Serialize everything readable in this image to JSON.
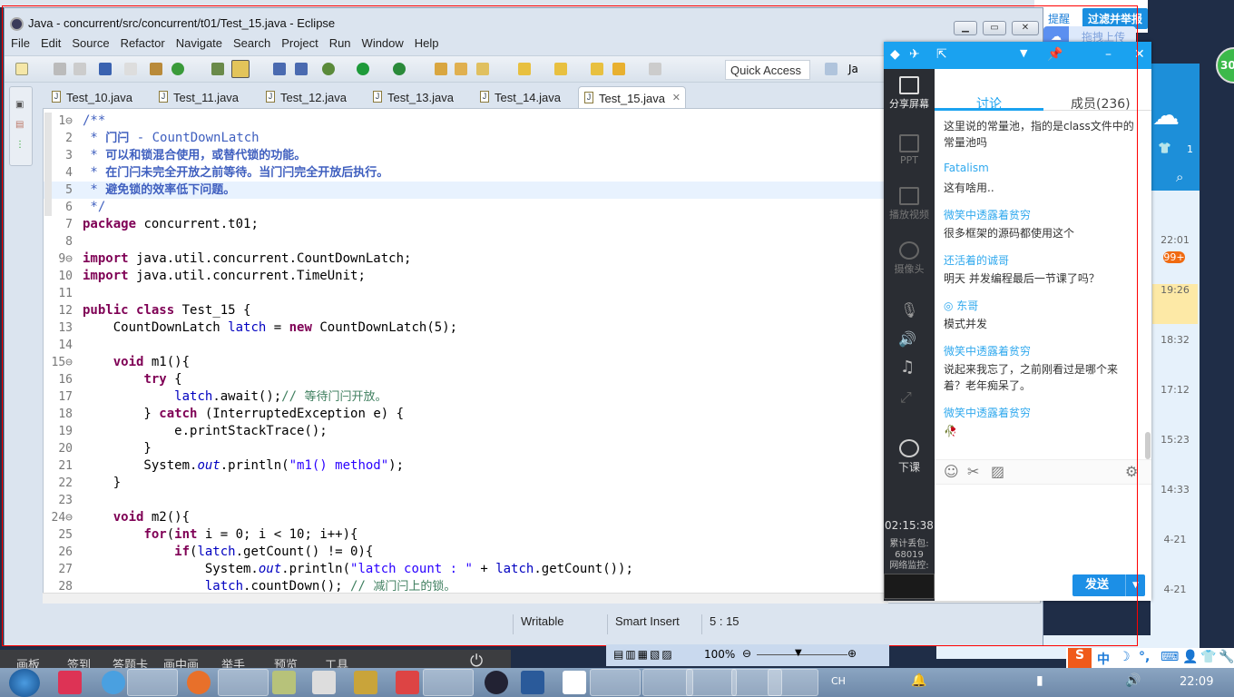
{
  "window": {
    "title": "Java - concurrent/src/concurrent/t01/Test_15.java - Eclipse"
  },
  "menu": [
    "File",
    "Edit",
    "Source",
    "Refactor",
    "Navigate",
    "Search",
    "Project",
    "Run",
    "Window",
    "Help"
  ],
  "toolbar": {
    "quick_access": "Quick Access",
    "perspective": "Ja"
  },
  "tabs": [
    {
      "label": "Test_10.java"
    },
    {
      "label": "Test_11.java"
    },
    {
      "label": "Test_12.java"
    },
    {
      "label": "Test_13.java"
    },
    {
      "label": "Test_14.java"
    },
    {
      "label": "Test_15.java",
      "active": true
    }
  ],
  "editor": {
    "current_line": 5,
    "lines": [
      [
        [
          "c",
          "/**"
        ]
      ],
      [
        [
          "c",
          " * "
        ],
        [
          "cz",
          "门闩"
        ],
        [
          "c",
          " - CountDownLatch"
        ]
      ],
      [
        [
          "c",
          " * "
        ],
        [
          "cz",
          "可以和锁混合使用，或替代锁的功能。"
        ]
      ],
      [
        [
          "c",
          " * "
        ],
        [
          "cz",
          "在门闩未完全开放之前等待。当门闩完全开放后执行。"
        ]
      ],
      [
        [
          "c",
          " * "
        ],
        [
          "cz",
          "避免锁的效率低下问题。"
        ]
      ],
      [
        [
          "c",
          " */"
        ]
      ],
      [
        [
          "k",
          "package"
        ],
        [
          "t",
          " concurrent.t01;"
        ]
      ],
      [],
      [
        [
          "k",
          "import"
        ],
        [
          "t",
          " java.util.concurrent.CountDownLatch;"
        ]
      ],
      [
        [
          "k",
          "import"
        ],
        [
          "t",
          " java.util.concurrent.TimeUnit;"
        ]
      ],
      [],
      [
        [
          "k",
          "public"
        ],
        [
          "t",
          " "
        ],
        [
          "k",
          "class"
        ],
        [
          "t",
          " Test_15 {"
        ]
      ],
      [
        [
          "t",
          "    CountDownLatch "
        ],
        [
          "f",
          "latch"
        ],
        [
          "t",
          " = "
        ],
        [
          "k",
          "new"
        ],
        [
          "t",
          " CountDownLatch(5);"
        ]
      ],
      [],
      [
        [
          "t",
          "    "
        ],
        [
          "k",
          "void"
        ],
        [
          "t",
          " m1(){"
        ]
      ],
      [
        [
          "t",
          "        "
        ],
        [
          "k",
          "try"
        ],
        [
          "t",
          " {"
        ]
      ],
      [
        [
          "t",
          "            "
        ],
        [
          "f",
          "latch"
        ],
        [
          "t",
          ".await();"
        ],
        [
          "cm",
          "// "
        ],
        [
          "cmz",
          "等待门闩开放。"
        ]
      ],
      [
        [
          "t",
          "        } "
        ],
        [
          "k",
          "catch"
        ],
        [
          "t",
          " (InterruptedException e) {"
        ]
      ],
      [
        [
          "t",
          "            e.printStackTrace();"
        ]
      ],
      [
        [
          "t",
          "        }"
        ]
      ],
      [
        [
          "t",
          "        System."
        ],
        [
          "i",
          "out"
        ],
        [
          "t",
          ".println("
        ],
        [
          "s",
          "\"m1() method\""
        ],
        [
          "t",
          ");"
        ]
      ],
      [
        [
          "t",
          "    }"
        ]
      ],
      [],
      [
        [
          "t",
          "    "
        ],
        [
          "k",
          "void"
        ],
        [
          "t",
          " m2(){"
        ]
      ],
      [
        [
          "t",
          "        "
        ],
        [
          "k",
          "for"
        ],
        [
          "t",
          "("
        ],
        [
          "k",
          "int"
        ],
        [
          "t",
          " i = 0; i < 10; i++){"
        ]
      ],
      [
        [
          "t",
          "            "
        ],
        [
          "k",
          "if"
        ],
        [
          "t",
          "("
        ],
        [
          "f",
          "latch"
        ],
        [
          "t",
          ".getCount() != 0){"
        ]
      ],
      [
        [
          "t",
          "                System."
        ],
        [
          "i",
          "out"
        ],
        [
          "t",
          ".println("
        ],
        [
          "s",
          "\"latch count : \""
        ],
        [
          "t",
          " + "
        ],
        [
          "f",
          "latch"
        ],
        [
          "t",
          ".getCount());"
        ]
      ],
      [
        [
          "t",
          "                "
        ],
        [
          "f",
          "latch"
        ],
        [
          "t",
          ".countDown(); "
        ],
        [
          "cm",
          "// "
        ],
        [
          "cmz",
          "减门闩上的锁。"
        ]
      ]
    ],
    "fold_lines": [
      1,
      9,
      15,
      24
    ]
  },
  "status": {
    "writable": "Writable",
    "insert_mode": "Smart Insert",
    "position": "5 : 15"
  },
  "overlay_top": {
    "remind": "提醒",
    "report": "过滤并举报",
    "upload": "拖拽上传",
    "badge": "30"
  },
  "chat": {
    "tabs": {
      "discussion": "讨论",
      "members": "成员(236)"
    },
    "side": [
      {
        "label": "分享屏幕",
        "icon": "share-screen-icon"
      },
      {
        "label": "PPT",
        "icon": "ppt-icon"
      },
      {
        "label": "播放视频",
        "icon": "play-video-icon"
      },
      {
        "label": "摄像头",
        "icon": "camera-icon"
      },
      {
        "label": "下课",
        "icon": "end-class-icon"
      }
    ],
    "timer": "02:15:38",
    "packet_loss_label": "累计丢包:",
    "packet_loss": "68019",
    "network_label": "网络监控:",
    "messages": [
      {
        "name": "",
        "text": "这里说的常量池，指的是class文件中的常量池吗"
      },
      {
        "name": "Fatalism",
        "text": "这有啥用.."
      },
      {
        "name": "微笑中透露着贫穷",
        "text": "很多框架的源码都使用这个"
      },
      {
        "name": "还活着的诚哥",
        "text": "明天 并发编程最后一节课了吗？"
      },
      {
        "name": "东哥",
        "text": "模式并发"
      },
      {
        "name": "微笑中透露着贫穷",
        "text": "说起来我忘了，之前刚看过是哪个来着？老年痴呆了。"
      },
      {
        "name": "微笑中透露着贫穷",
        "text": "🥀"
      }
    ],
    "send": "发送"
  },
  "qq": {
    "times": [
      "22:01",
      "19:26",
      "18:32",
      "17:12",
      "15:23",
      "14:33",
      "4-21",
      "4-21"
    ],
    "unread": "99+",
    "count": "1"
  },
  "classbar": [
    "画板",
    "签到",
    "答题卡",
    "画中画",
    "举手",
    "预览",
    "工具"
  ],
  "word": {
    "zoom": "100%"
  },
  "ime": {
    "mode": "中"
  },
  "taskbar": {
    "lang": "CH",
    "time": "22:09"
  }
}
